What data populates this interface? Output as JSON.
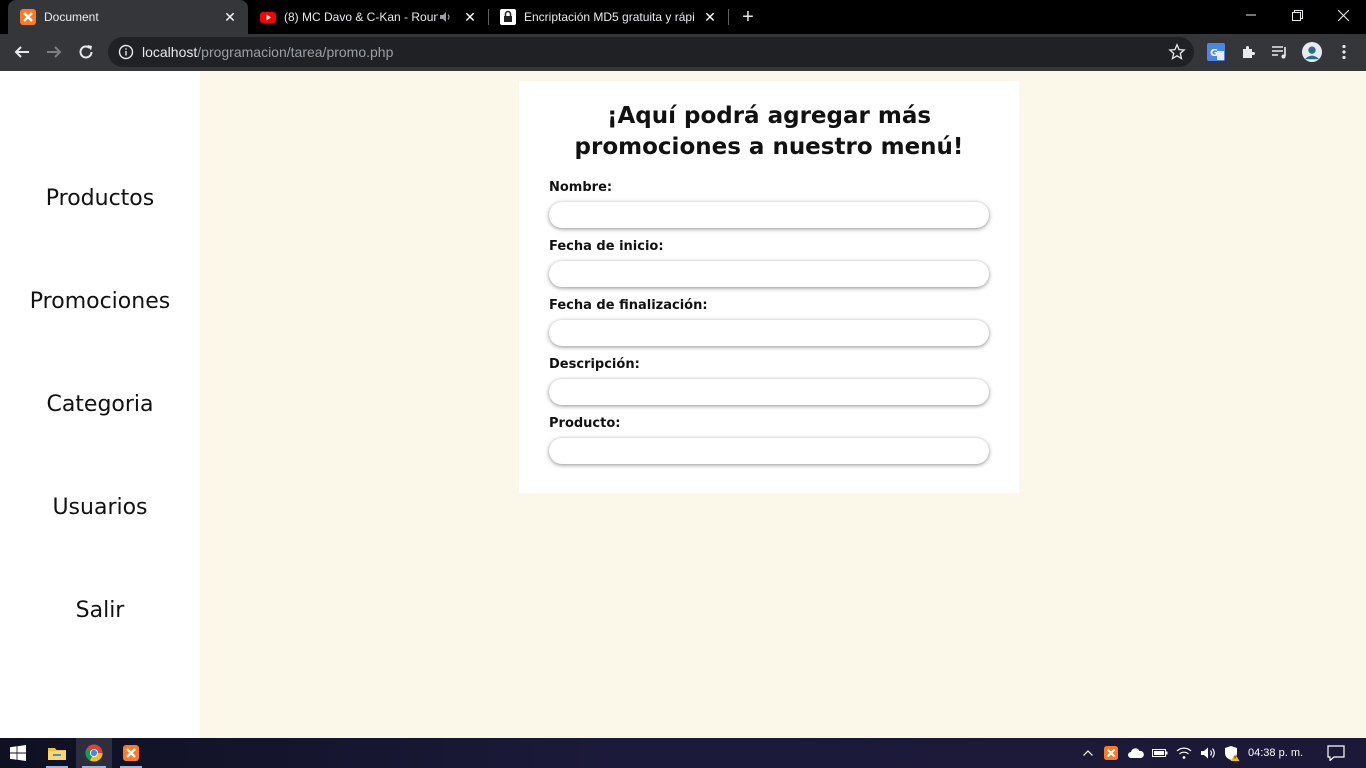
{
  "browser": {
    "tabs": [
      {
        "title": "Document",
        "icon": "xampp-icon",
        "active": true
      },
      {
        "title": "(8) MC Davo & C-Kan - Roun",
        "icon": "youtube-icon",
        "active": false
      },
      {
        "title": "Encriptación MD5 gratuita y rápi",
        "icon": "lock-icon",
        "active": false
      }
    ],
    "url_host": "localhost",
    "url_path": "/programacion/tarea/promo.php"
  },
  "sidebar": {
    "items": [
      {
        "label": "Productos"
      },
      {
        "label": "Promociones"
      },
      {
        "label": "Categoria"
      },
      {
        "label": "Usuarios"
      },
      {
        "label": "Salir"
      }
    ]
  },
  "form": {
    "title": "¡Aquí podrá agregar más promociones a nuestro menú!",
    "fields": [
      {
        "label": "Nombre:",
        "value": ""
      },
      {
        "label": "Fecha de inicio:",
        "value": ""
      },
      {
        "label": "Fecha de finalización:",
        "value": ""
      },
      {
        "label": "Descripción:",
        "value": ""
      },
      {
        "label": "Producto:",
        "value": ""
      }
    ]
  },
  "taskbar": {
    "clock": "04:38 p. m."
  }
}
